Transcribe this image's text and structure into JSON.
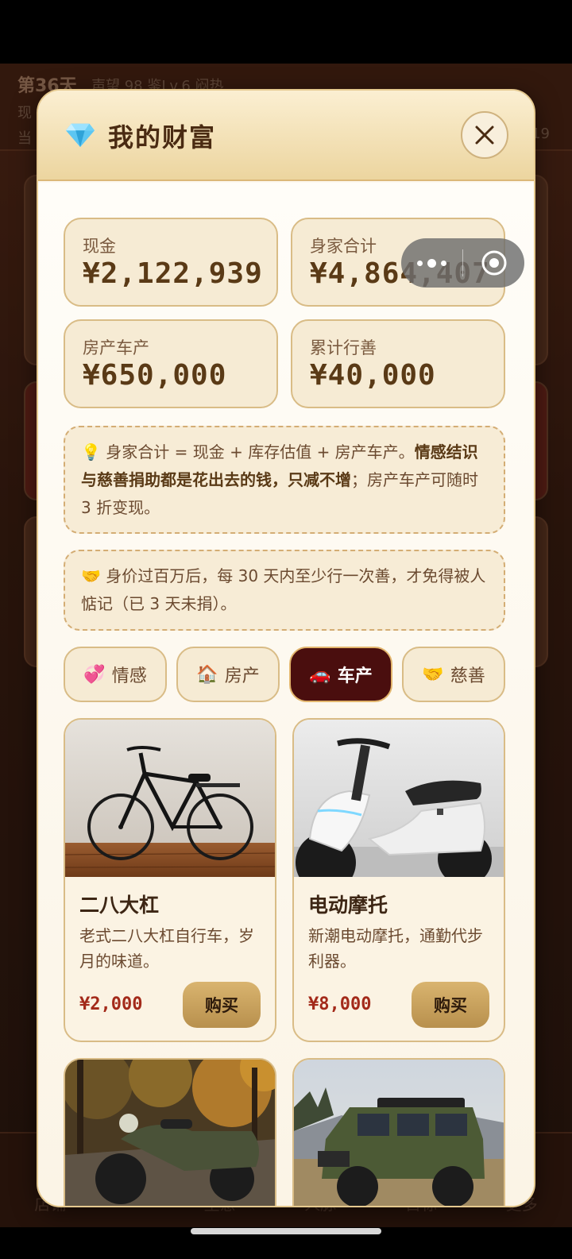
{
  "background": {
    "day": "第36天",
    "status": "声望 98 鉴Lv.6 闷热",
    "line2": "现",
    "line3": "当",
    "right_value": "19",
    "nav": [
      "店铺",
      "",
      "生意",
      "人脉",
      "目标",
      "更多"
    ]
  },
  "modal": {
    "title": "我的财富",
    "stats": [
      {
        "label": "现金",
        "value": "¥2,122,939"
      },
      {
        "label": "身家合计",
        "value": "¥4,864,407"
      },
      {
        "label": "房产车产",
        "value": "¥650,000"
      },
      {
        "label": "累计行善",
        "value": "¥40,000"
      }
    ],
    "note1": {
      "icon": "💡",
      "text_a": "身家合计 = 现金 + 库存估值 + 房产车产。",
      "text_bold": "情感结识与慈善捐助都是花出去的钱，只减不增",
      "text_b": "；房产车产可随时 3 折变现。"
    },
    "note2": {
      "icon": "🤝",
      "text": "身价过百万后，每 30 天内至少行一次善，才免得被人惦记（已 3 天未捐）。"
    },
    "tabs": [
      {
        "icon": "💞",
        "label": "情感"
      },
      {
        "icon": "🏠",
        "label": "房产"
      },
      {
        "icon": "🚗",
        "label": "车产"
      },
      {
        "icon": "🤝",
        "label": "慈善"
      }
    ],
    "active_tab": "车产",
    "items": [
      {
        "name": "二八大杠",
        "desc": "老式二八大杠自行车，岁月的味道。",
        "price": "¥2,000",
        "buy": "购买"
      },
      {
        "name": "电动摩托",
        "desc": "新潮电动摩托，通勤代步利器。",
        "price": "¥8,000",
        "buy": "购买"
      },
      {
        "name": "",
        "desc": "",
        "price": "",
        "buy": ""
      },
      {
        "name": "",
        "desc": "",
        "price": "",
        "buy": ""
      }
    ]
  },
  "colors": {
    "accent_gold": "#d9b46f",
    "active_tab_bg": "#4a0e0e",
    "price_red": "#a32a1a"
  }
}
